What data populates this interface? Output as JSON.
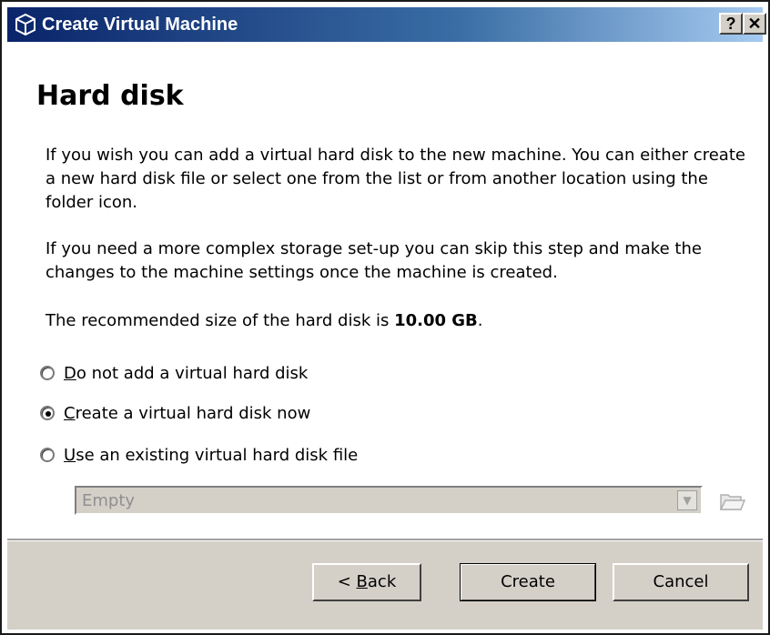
{
  "window": {
    "title": "Create Virtual Machine",
    "help_glyph": "?",
    "close_glyph": "✕"
  },
  "page": {
    "heading": "Hard disk",
    "paragraph1": "If you wish you can add a virtual hard disk to the new machine. You can either create a new hard disk file or select one from the list or from another location using the folder icon.",
    "paragraph2": "If you need a more complex storage set-up you can skip this step and make the changes to the machine settings once the machine is created.",
    "recommend_prefix": "The recommended size of the hard disk is ",
    "recommend_size": "10.00 GB",
    "recommend_suffix": "."
  },
  "options": [
    {
      "label": "Do not add a virtual hard disk",
      "checked": false
    },
    {
      "label": "Create a virtual hard disk now",
      "checked": true
    },
    {
      "label": "Use an existing virtual hard disk file",
      "checked": false
    }
  ],
  "disk_select": {
    "value": "Empty",
    "enabled": false
  },
  "buttons": {
    "back": "< Back",
    "create": "Create",
    "cancel": "Cancel"
  }
}
